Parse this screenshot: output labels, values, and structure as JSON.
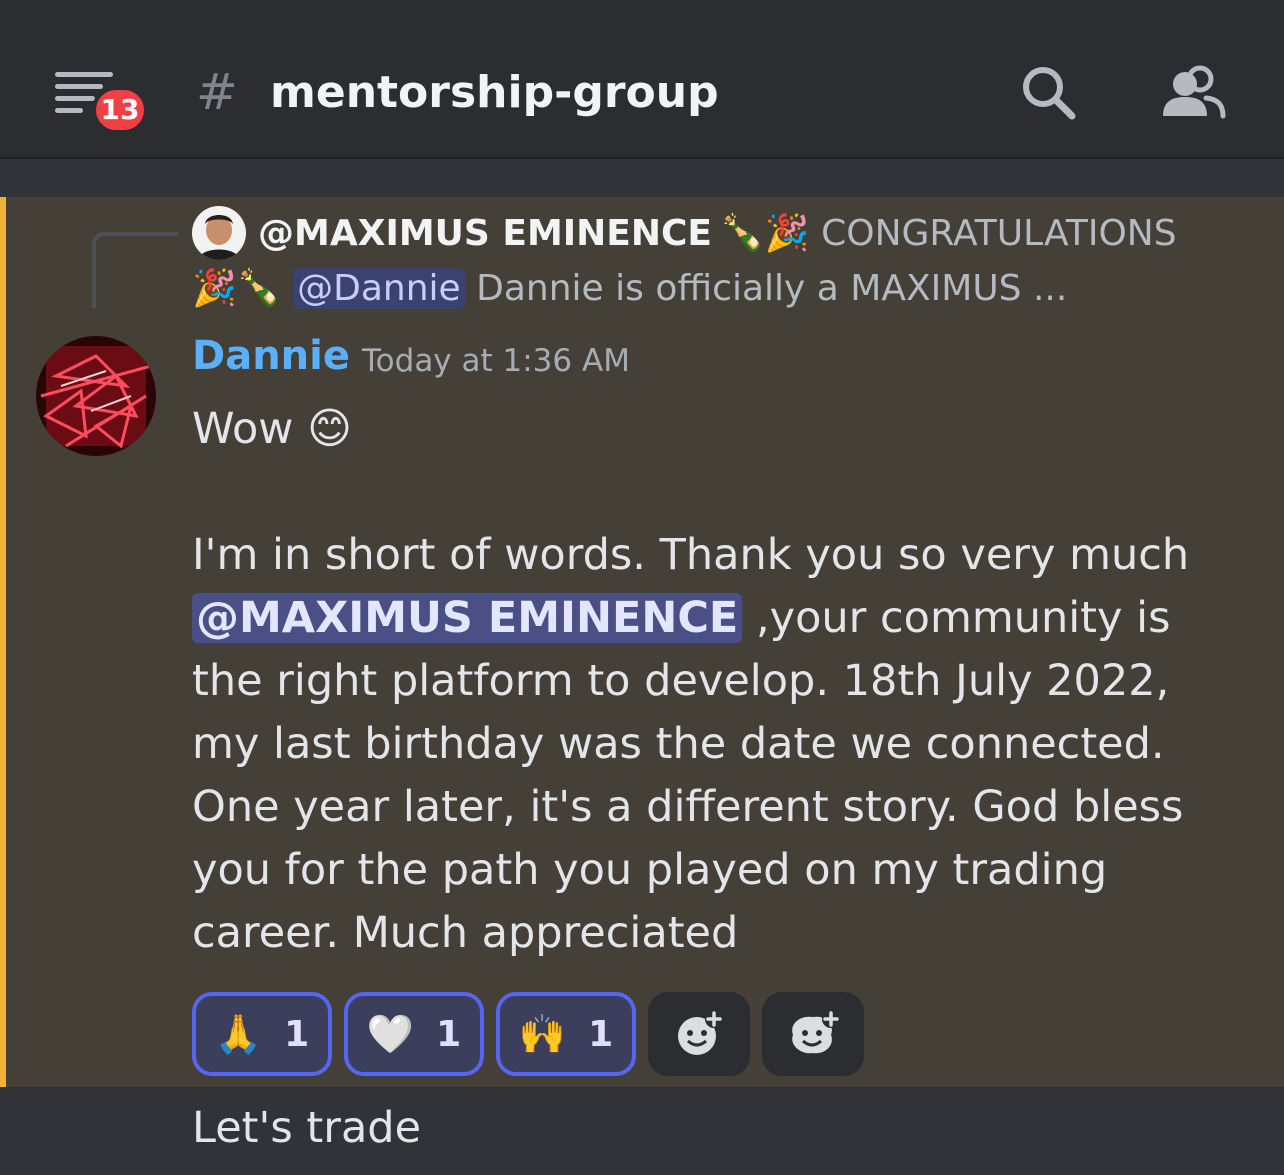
{
  "header": {
    "badge_count": "13",
    "hash_symbol": "#",
    "channel_name": "mentorship-group",
    "icons": [
      "menu-icon",
      "search-icon",
      "members-icon"
    ]
  },
  "reply": {
    "author": "@MAXIMUS EMINENCE",
    "line1_emojis": "🍾🎉",
    "line1_text": "CONGRATULATIONS",
    "line2_emojis": "🎉🍾",
    "mention": "@Dannie",
    "line2_text": "Dannie is officially a  MAXIMUS ..."
  },
  "message": {
    "author": "Dannie",
    "timestamp": "Today at 1:36 AM",
    "wow_text": "Wow",
    "wow_emoji": "😊",
    "paragraph_start": "I'm in short of words. Thank you so very much",
    "mention": "@MAXIMUS EMINENCE",
    "paragraph_end": " ,your community is the right platform to develop. 18th July 2022, my last birthday was the date we connected. One year later, it's a different story. God bless you for the path you played on my trading career. Much appreciated"
  },
  "reactions": [
    {
      "emoji": "🙏",
      "count": "1"
    },
    {
      "emoji": "🤍",
      "count": "1"
    },
    {
      "emoji": "🙌",
      "count": "1"
    }
  ],
  "next_message": {
    "text": "Let's trade"
  },
  "colors": {
    "highlight_bar": "#f0b232",
    "author": "#5ab0ff",
    "badge": "#f23f43",
    "reaction_border": "#5865f2"
  }
}
